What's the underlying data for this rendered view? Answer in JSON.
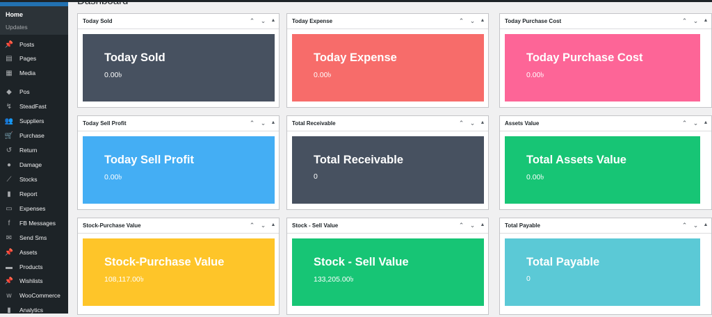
{
  "page": {
    "title": "Dashboard"
  },
  "sidebar": {
    "home": "Home",
    "updates": "Updates",
    "items": [
      {
        "label": "Posts",
        "icon": "pin-icon"
      },
      {
        "label": "Pages",
        "icon": "pages-icon"
      },
      {
        "label": "Media",
        "icon": "media-icon"
      },
      {
        "label": "Pos",
        "icon": "tag-icon"
      },
      {
        "label": "SteadFast",
        "icon": "delivery-icon"
      },
      {
        "label": "Suppliers",
        "icon": "users-icon"
      },
      {
        "label": "Purchase",
        "icon": "cart-icon"
      },
      {
        "label": "Return",
        "icon": "return-icon"
      },
      {
        "label": "Damage",
        "icon": "alert-icon"
      },
      {
        "label": "Stocks",
        "icon": "chart-line-icon"
      },
      {
        "label": "Report",
        "icon": "bar-chart-icon"
      },
      {
        "label": "Expenses",
        "icon": "money-icon"
      },
      {
        "label": "FB Messages",
        "icon": "facebook-icon"
      },
      {
        "label": "Send Sms",
        "icon": "sms-icon"
      },
      {
        "label": "Assets",
        "icon": "pin-icon"
      },
      {
        "label": "Products",
        "icon": "archive-icon"
      },
      {
        "label": "Wishlists",
        "icon": "pin-icon"
      },
      {
        "label": "WooCommerce",
        "icon": "woo-icon"
      },
      {
        "label": "Analytics",
        "icon": "bar-chart-icon"
      }
    ]
  },
  "widgets": [
    {
      "header": "Today Sold",
      "title": "Today Sold",
      "value": "0.00৳",
      "color": "#475160"
    },
    {
      "header": "Today Expense",
      "title": "Today Expense",
      "value": "0.00৳",
      "color": "#f76c6a"
    },
    {
      "header": "Today Purchase Cost",
      "title": "Today Purchase Cost",
      "value": "0.00৳",
      "color": "#fd6597"
    },
    {
      "header": "Today Sell Profit",
      "title": "Today Sell Profit",
      "value": "0.00৳",
      "color": "#44aef4"
    },
    {
      "header": "Total Receivable",
      "title": "Total Receivable",
      "value": "0",
      "color": "#475160"
    },
    {
      "header": "Assets Value",
      "title": "Total Assets Value",
      "value": "0.00৳",
      "color": "#17c575"
    },
    {
      "header": "Stock-Purchase Value",
      "title": "Stock-Purchase Value",
      "value": "108,117.00৳",
      "color": "#fec529"
    },
    {
      "header": "Stock - Sell Value",
      "title": "Stock - Sell Value",
      "value": "133,205.00৳",
      "color": "#17c575"
    },
    {
      "header": "Total Payable",
      "title": "Total Payable",
      "value": "0",
      "color": "#5bc9d6"
    }
  ],
  "controls": {
    "up": "⌃",
    "down": "⌄",
    "toggle": "▲"
  }
}
